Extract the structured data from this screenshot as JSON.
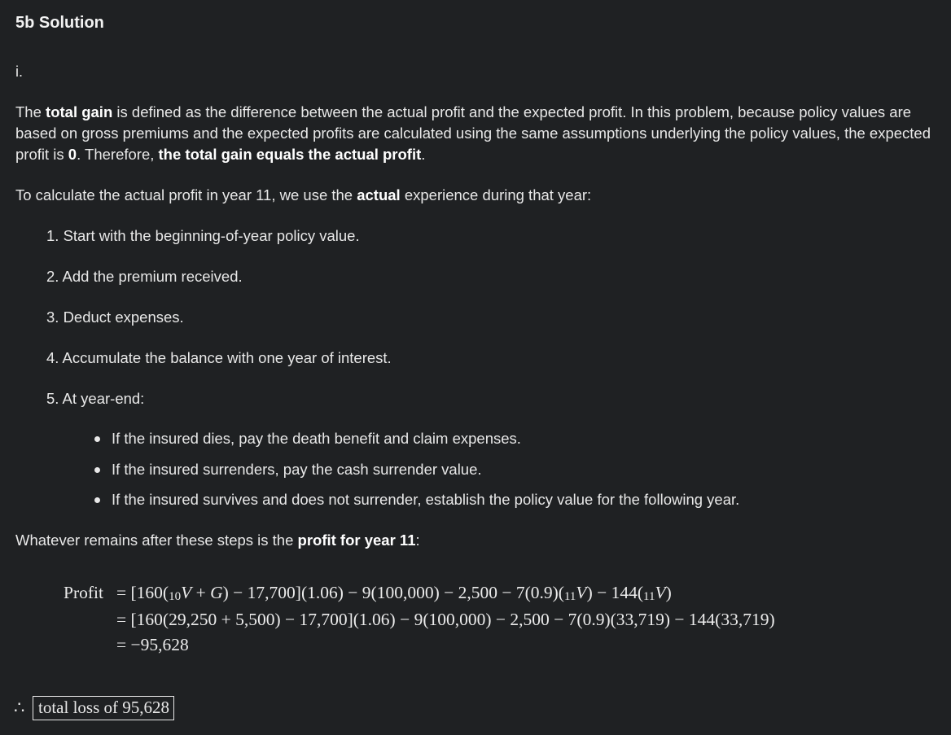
{
  "heading": "5b Solution",
  "part_marker": "i.",
  "intro": {
    "t1": "The ",
    "b1": "total gain",
    "t2": " is defined as the difference between the actual profit and the expected profit. In this problem, because policy values are based on gross premiums and the expected profits are calculated using the same assumptions underlying the policy values, the expected profit is ",
    "b2": "0",
    "t3": ". Therefore, ",
    "b3": "the total gain equals the actual profit",
    "t4": "."
  },
  "calc_intro": {
    "t1": "To calculate the actual profit in year 11, we use the ",
    "b1": "actual",
    "t2": " experience during that year:"
  },
  "steps": [
    "1. Start with the beginning-of-year policy value.",
    "2. Add the premium received.",
    "3. Deduct expenses.",
    "4. Accumulate the balance with one year of interest.",
    "5. At year-end:"
  ],
  "bullets": [
    "If the insured dies, pay the death benefit and claim expenses.",
    "If the insured surrenders, pay the cash surrender value.",
    "If the insured survives and does not surrender, establish the policy value for the following year."
  ],
  "remainder": {
    "t1": "Whatever remains after these steps is the ",
    "b1": "profit for year 11",
    "t2": ":"
  },
  "equation": {
    "lhs": "Profit",
    "line1": {
      "a": "= [160(",
      "s1": "10",
      "b": "V",
      "c": " + ",
      "d": "G",
      "e": ") − 17,700](1.06) − 9(100,000) − 2,500 − 7(0.9)(",
      "s2": "11",
      "f": "V",
      "g": ") − 144(",
      "s3": "11",
      "h": "V",
      "i": ")"
    },
    "line2": "= [160(29,250 + 5,500) − 17,700](1.06) − 9(100,000) − 2,500 − 7(0.9)(33,719) − 144(33,719)",
    "line3": "= −95,628"
  },
  "conclusion": {
    "symbol": "∴",
    "boxed": "total loss of 95,628"
  }
}
